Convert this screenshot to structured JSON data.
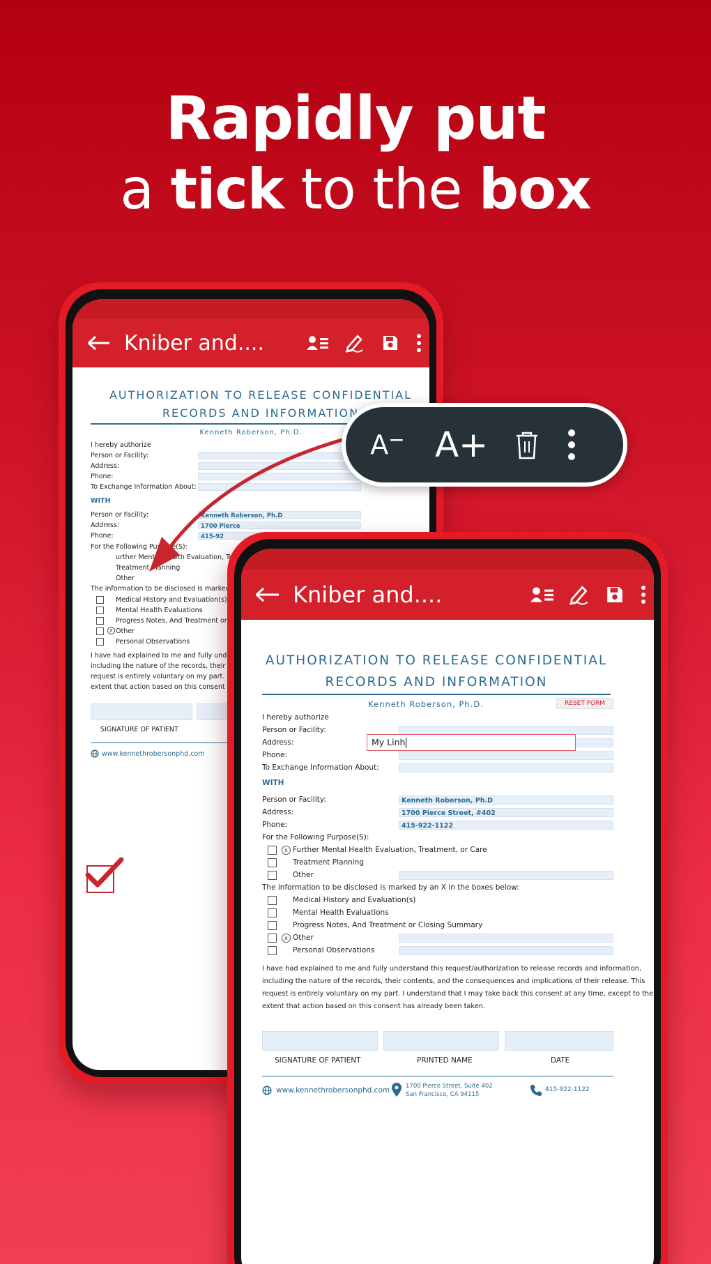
{
  "headline": {
    "line1": "Rapidly put",
    "line2_a": "a",
    "line2_tick": "tick",
    "line2_to_the": "to the",
    "line2_box": "box"
  },
  "colors": {
    "brand_red": "#d4202a",
    "doc_blue": "#2c6b91",
    "field_bg": "#e6eef8",
    "popup_bg": "#263238"
  },
  "appbar": {
    "title": "Kniber and....",
    "icons": [
      "back-arrow-icon",
      "contact-list-icon",
      "pen-sign-icon",
      "save-icon",
      "more-vert-icon"
    ]
  },
  "popup": {
    "decrease_label": "A",
    "decrease_sup": "−",
    "increase_label": "A+",
    "icons": [
      "trash-icon",
      "more-vert-icon"
    ]
  },
  "document": {
    "title_line1": "AUTHORIZATION TO RELEASE CONFIDENTIAL",
    "title_line2": "RECORDS AND INFORMATION",
    "author": "Kenneth Roberson, Ph.D.",
    "reset": "RESET FORM",
    "hereby": "I hereby authorize",
    "person": "Person or Facility:",
    "address": "Address:",
    "phone": "Phone:",
    "exchange": "To Exchange Information About:",
    "typed_address": "My Linh",
    "with": "WITH",
    "with_person_value": "Kenneth Roberson, Ph.D",
    "with_address_value": "1700 Pierce Street, #402",
    "with_phone_value": "415-922-1122",
    "back_with_person_value": "Kenneth Roberson, Ph.D",
    "back_with_address_value": "1700 Pierce",
    "back_with_phone_value": "415-92",
    "purposes_label": "For the Following Purpose(S):",
    "purposes": [
      "Further Mental Health Evaluation, Treatment, or Care",
      "Treatment Planning",
      "Other"
    ],
    "back_purpose_1": "urther Mental Health Evaluation, Treat",
    "disclosed_label": "The information to be disclosed is marked by an X in the boxes below:",
    "back_disclosed_label": "The information to be disclosed is marked by an",
    "disclosed": [
      "Medical History and Evaluation(s)",
      "Mental Health Evaluations",
      "Progress Notes, And Treatment or Closing Summary",
      "Other",
      "Personal Observations"
    ],
    "back_disclosed_3": "Progress Notes, And Treatment or Closin",
    "paragraph": [
      "I have had explained to me and fully understand this request/authorization to release records and information,",
      "including the nature of the records, their contents, and the consequences and implications of their release. This",
      "request is entirely voluntary on my part. I understand that I may take back this consent at any time, except to the",
      "extent that action based on this consent has already been taken."
    ],
    "back_paragraph": [
      "I have had explained to me and fully understand",
      "including the nature of the records, their conte",
      "request is entirely voluntary on my part. I unde",
      "extent that action based on this consent has alre"
    ],
    "sig_patient": "SIGNATURE OF PATIENT",
    "sig_printed": "PRINTED NAME",
    "sig_date": "DATE",
    "footer_web": "www.kennethrobersonphd.com",
    "footer_addr1": "1700 Pierce Street, Suite 402",
    "footer_addr2": "San Francisco, CA 94115",
    "footer_phone": "415-922-1122"
  }
}
